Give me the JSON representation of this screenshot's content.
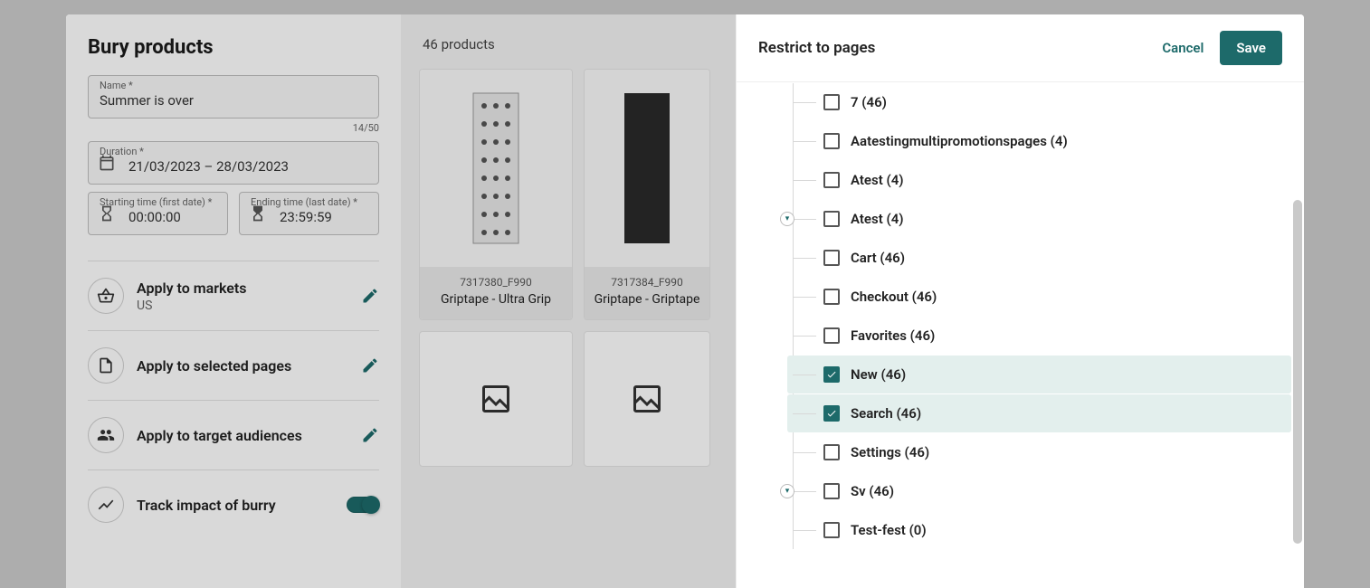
{
  "modal": {
    "title": "Bury products",
    "name": {
      "label": "Name *",
      "value": "Summer is over",
      "counter": "14/50"
    },
    "duration": {
      "label": "Duration *",
      "value": "21/03/2023 – 28/03/2023"
    },
    "start": {
      "label": "Starting time (first date) *",
      "value": "00:00:00"
    },
    "end": {
      "label": "Ending time (last date) *",
      "value": "23:59:59"
    },
    "settings": {
      "markets": {
        "title": "Apply to markets",
        "sub": "US"
      },
      "pages": {
        "title": "Apply to selected pages"
      },
      "audiences": {
        "title": "Apply to target audiences"
      },
      "track": {
        "title": "Track impact of burry"
      }
    }
  },
  "products": {
    "count_label": "46 products",
    "items": [
      {
        "sku": "7317380_F990",
        "name": "Griptape - Ultra Grip"
      },
      {
        "sku": "7317384_F990",
        "name": "Griptape - Griptape"
      }
    ]
  },
  "right": {
    "title": "Restrict to pages",
    "cancel": "Cancel",
    "save": "Save",
    "tree": [
      {
        "label": "7 (46)",
        "checked": false,
        "expander": false
      },
      {
        "label": "Aatestingmultipromotionspages (4)",
        "checked": false,
        "expander": false
      },
      {
        "label": "Atest (4)",
        "checked": false,
        "expander": false
      },
      {
        "label": "Atest (4)",
        "checked": false,
        "expander": true
      },
      {
        "label": "Cart (46)",
        "checked": false,
        "expander": false
      },
      {
        "label": "Checkout (46)",
        "checked": false,
        "expander": false
      },
      {
        "label": "Favorites (46)",
        "checked": false,
        "expander": false
      },
      {
        "label": "New (46)",
        "checked": true,
        "expander": false
      },
      {
        "label": "Search (46)",
        "checked": true,
        "expander": false
      },
      {
        "label": "Settings (46)",
        "checked": false,
        "expander": false
      },
      {
        "label": "Sv (46)",
        "checked": false,
        "expander": true
      },
      {
        "label": "Test-fest (0)",
        "checked": false,
        "expander": false
      }
    ]
  }
}
